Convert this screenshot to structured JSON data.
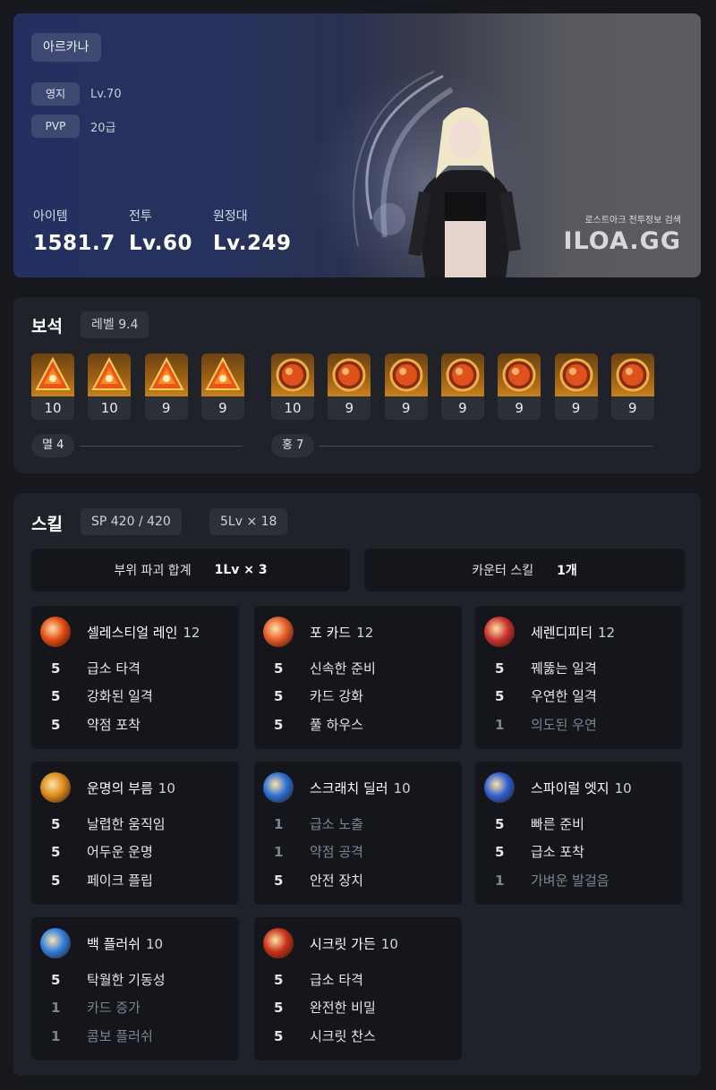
{
  "profile": {
    "name": "아르카나",
    "rows": [
      {
        "tag": "영지",
        "value": "Lv.70"
      },
      {
        "tag": "PVP",
        "value": "20급"
      }
    ],
    "stats": [
      {
        "label": "아이템",
        "value": "1581.7"
      },
      {
        "label": "전투",
        "value": "Lv.60"
      },
      {
        "label": "원정대",
        "value": "Lv.249"
      }
    ],
    "brand_sub": "로스트아크 전투정보 검색",
    "brand_logo": "ILOA.GG"
  },
  "gems": {
    "title": "보석",
    "level_chip": "레벨 9.4",
    "groups": [
      {
        "name": "멸 4",
        "kind": "damage",
        "levels": [
          "10",
          "10",
          "9",
          "9"
        ]
      },
      {
        "name": "홍 7",
        "kind": "cooldown",
        "levels": [
          "10",
          "9",
          "9",
          "9",
          "9",
          "9",
          "9"
        ]
      }
    ]
  },
  "skills": {
    "title": "스킬",
    "sp_chip": "SP 420 / 420",
    "lv_chip": "5Lv × 18",
    "summary": [
      {
        "label": "부위 파괴 합계",
        "value": "1Lv × 3"
      },
      {
        "label": "카운터 스킬",
        "value": "1개"
      }
    ],
    "cards": [
      {
        "name": "셀레스티얼 레인",
        "level": "12",
        "icon": "celestial-rain-icon",
        "color": "#e04a12",
        "tripods": [
          {
            "lv": "5",
            "name": "급소 타격",
            "active": true
          },
          {
            "lv": "5",
            "name": "강화된 일격",
            "active": true
          },
          {
            "lv": "5",
            "name": "약점 포착",
            "active": true
          }
        ]
      },
      {
        "name": "포 카드",
        "level": "12",
        "icon": "four-card-icon",
        "color": "#e35a28",
        "tripods": [
          {
            "lv": "5",
            "name": "신속한 준비",
            "active": true
          },
          {
            "lv": "5",
            "name": "카드 강화",
            "active": true
          },
          {
            "lv": "5",
            "name": "풀 하우스",
            "active": true
          }
        ]
      },
      {
        "name": "세렌디피티",
        "level": "12",
        "icon": "serendipity-icon",
        "color": "#c9322e",
        "tripods": [
          {
            "lv": "5",
            "name": "꿰뚫는 일격",
            "active": true
          },
          {
            "lv": "5",
            "name": "우연한 일격",
            "active": true
          },
          {
            "lv": "1",
            "name": "의도된 우연",
            "active": false
          }
        ]
      },
      {
        "name": "운명의 부름",
        "level": "10",
        "icon": "call-of-destiny-icon",
        "color": "#d98a1a",
        "tripods": [
          {
            "lv": "5",
            "name": "날렵한 움직임",
            "active": true
          },
          {
            "lv": "5",
            "name": "어두운 운명",
            "active": true
          },
          {
            "lv": "5",
            "name": "페이크 플립",
            "active": true
          }
        ]
      },
      {
        "name": "스크래치 딜러",
        "level": "10",
        "icon": "scratch-dealer-icon",
        "color": "#2a6fd6",
        "tripods": [
          {
            "lv": "1",
            "name": "급소 노출",
            "active": false
          },
          {
            "lv": "1",
            "name": "약점 공격",
            "active": false
          },
          {
            "lv": "5",
            "name": "안전 장치",
            "active": true
          }
        ]
      },
      {
        "name": "스파이럴 엣지",
        "level": "10",
        "icon": "spiral-edge-icon",
        "color": "#2f5fd0",
        "tripods": [
          {
            "lv": "5",
            "name": "빠른 준비",
            "active": true
          },
          {
            "lv": "5",
            "name": "급소 포착",
            "active": true
          },
          {
            "lv": "1",
            "name": "가벼운 발걸음",
            "active": false
          }
        ]
      },
      {
        "name": "백 플러쉬",
        "level": "10",
        "icon": "back-flush-icon",
        "color": "#2e7fe0",
        "tripods": [
          {
            "lv": "5",
            "name": "탁월한 기동성",
            "active": true
          },
          {
            "lv": "1",
            "name": "카드 증가",
            "active": false
          },
          {
            "lv": "1",
            "name": "콤보 플러쉬",
            "active": false
          }
        ]
      },
      {
        "name": "시크릿 가든",
        "level": "10",
        "icon": "secret-garden-icon",
        "color": "#c8321a",
        "tripods": [
          {
            "lv": "5",
            "name": "급소 타격",
            "active": true
          },
          {
            "lv": "5",
            "name": "완전한 비밀",
            "active": true
          },
          {
            "lv": "5",
            "name": "시크릿 찬스",
            "active": true
          }
        ]
      }
    ]
  }
}
